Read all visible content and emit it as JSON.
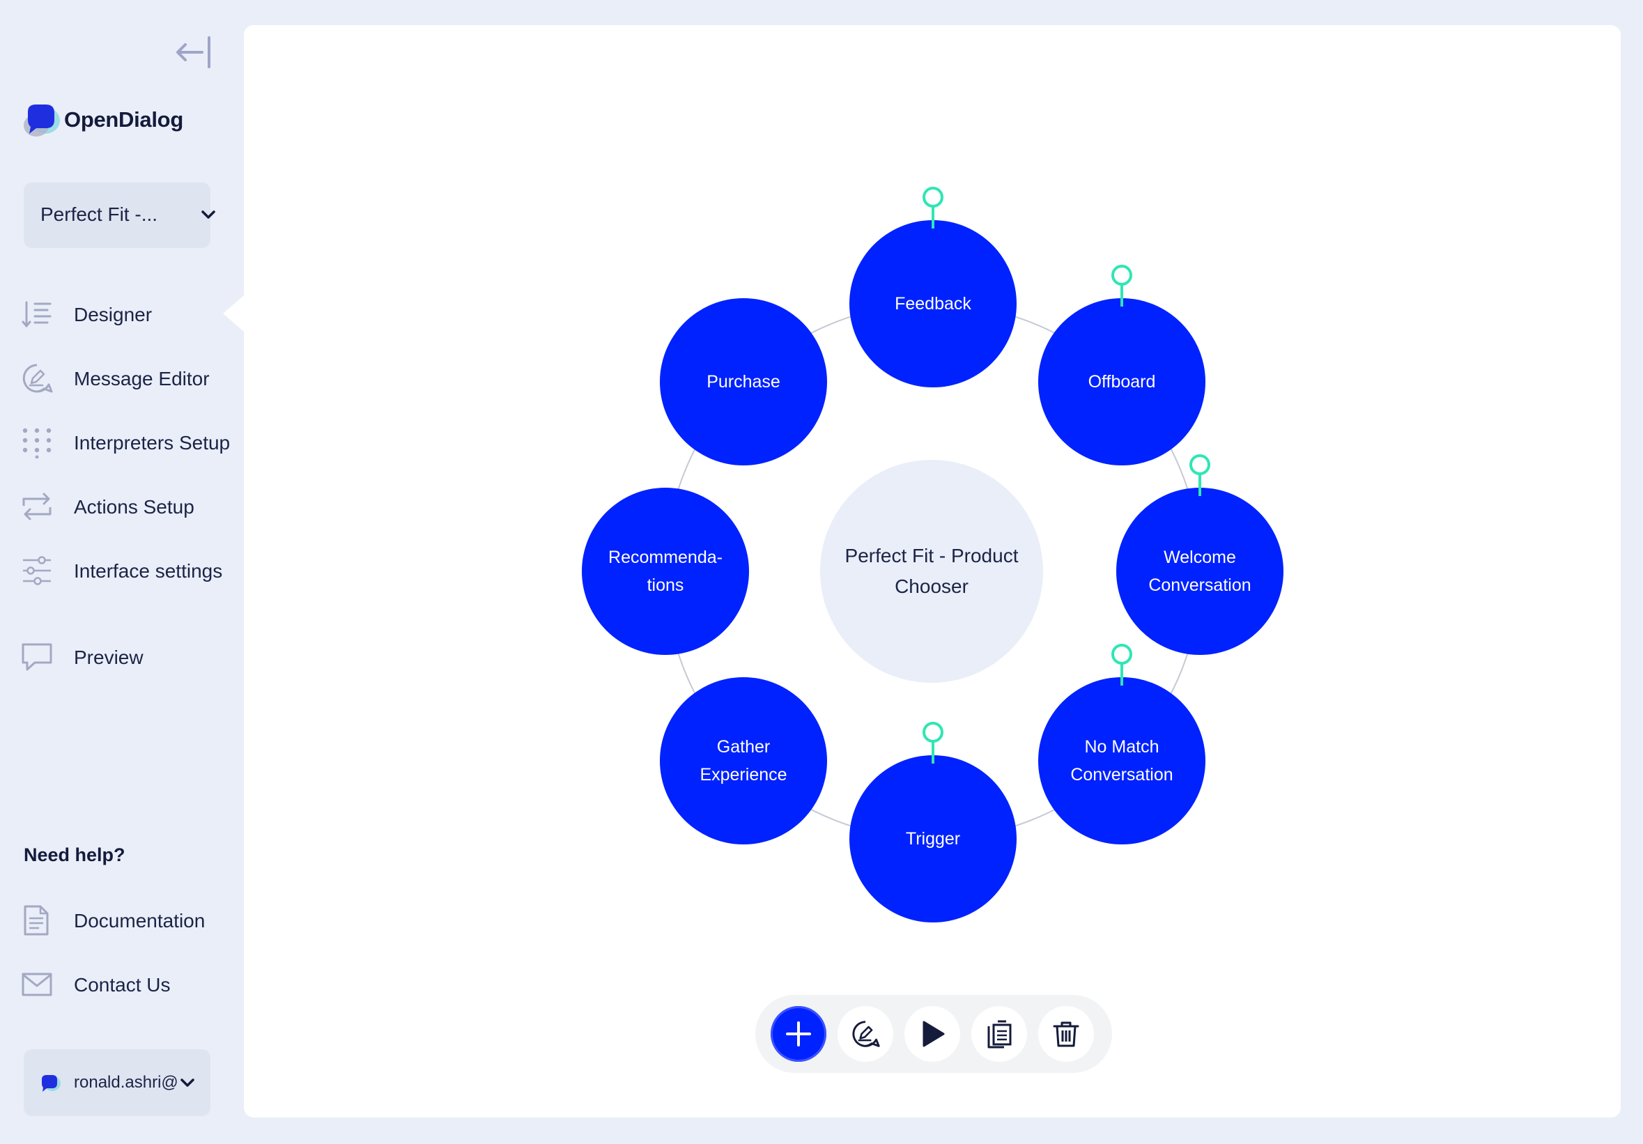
{
  "app": {
    "logo_text": "OpenDialog",
    "scenario_selector": {
      "value": "Perfect Fit -..."
    }
  },
  "sidebar": {
    "nav": [
      {
        "label": "Designer",
        "icon": "designer-icon",
        "active": true
      },
      {
        "label": "Message Editor",
        "icon": "message-editor-icon"
      },
      {
        "label": "Interpreters Setup",
        "icon": "interpreters-icon"
      },
      {
        "label": "Actions Setup",
        "icon": "actions-icon"
      },
      {
        "label": "Interface settings",
        "icon": "sliders-icon"
      },
      {
        "label": "Preview",
        "icon": "preview-icon"
      }
    ],
    "help": {
      "heading": "Need help?",
      "items": [
        {
          "label": "Documentation",
          "icon": "document-icon"
        },
        {
          "label": "Contact Us",
          "icon": "mail-icon"
        }
      ]
    },
    "user": {
      "name": "ronald.ashri@"
    }
  },
  "canvas": {
    "center": {
      "label": "Perfect Fit - Product Chooser"
    },
    "conversations": [
      {
        "label": "Feedback",
        "pinned": true
      },
      {
        "label": "Offboard",
        "pinned": true
      },
      {
        "label": "Welcome Conversation",
        "pinned": true
      },
      {
        "label": "No Match Conversation",
        "pinned": true
      },
      {
        "label": "Trigger",
        "pinned": true
      },
      {
        "label": "Gather Experience",
        "pinned": false
      },
      {
        "label": "Recommenda-tions",
        "pinned": false
      },
      {
        "label": "Purchase",
        "pinned": false
      }
    ],
    "colors": {
      "node": "#0022fe",
      "center": "#e9eef8",
      "pin": "#2fe6b4",
      "orbit": "#c7c9d3"
    }
  },
  "toolbar": {
    "buttons": [
      {
        "name": "add-button",
        "icon": "plus-icon"
      },
      {
        "name": "edit-messages-button",
        "icon": "chat-edit-icon"
      },
      {
        "name": "preview-play-button",
        "icon": "play-icon"
      },
      {
        "name": "duplicate-button",
        "icon": "duplicate-icon"
      },
      {
        "name": "delete-button",
        "icon": "trash-icon"
      }
    ]
  }
}
